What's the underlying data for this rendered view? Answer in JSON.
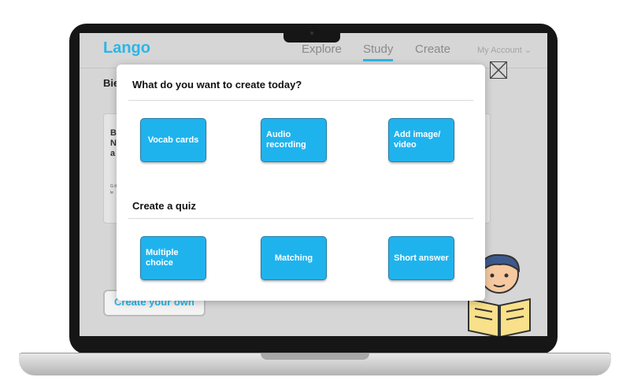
{
  "app": {
    "logo": "Lango",
    "nav": [
      "Explore",
      "Study",
      "Create"
    ],
    "active_nav": "Study",
    "account": "My Account ⌄"
  },
  "background": {
    "page_title": "Bie",
    "card_text": "B N a",
    "card_small": "G th le",
    "create_own": "Create your own",
    "close_icon": "close-icon"
  },
  "modal": {
    "create_heading": "What do you want to create today?",
    "create_options": [
      "Vocab cards",
      "Audio recording",
      "Add image/ video"
    ],
    "quiz_heading": "Create a quiz",
    "quiz_options": [
      "Multiple choice",
      "Matching",
      "Short answer"
    ]
  },
  "colors": {
    "accent": "#1fb3ee",
    "button_border": "#2a7ea6",
    "logo": "#2bb5e8"
  }
}
